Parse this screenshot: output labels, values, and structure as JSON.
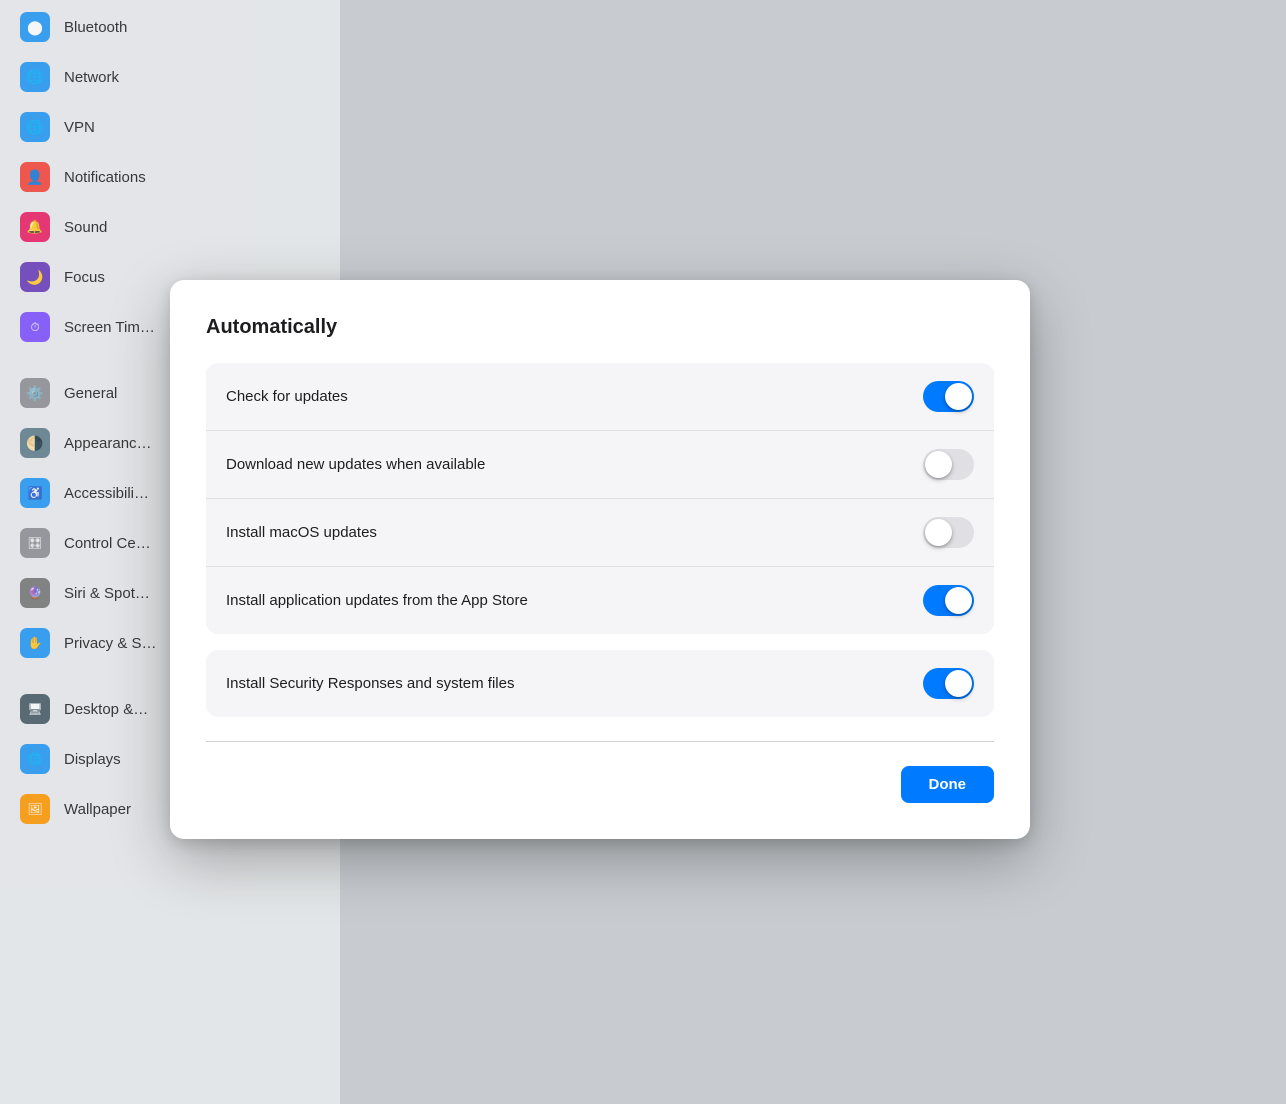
{
  "sidebar": {
    "items": [
      {
        "id": "bluetooth",
        "label": "Bluetooth",
        "icon": "🦷",
        "color": "#2196f3"
      },
      {
        "id": "network",
        "label": "Network",
        "icon": "🌐",
        "color": "#2196f3"
      },
      {
        "id": "vpn",
        "label": "VPN",
        "icon": "🌐",
        "color": "#2196f3"
      },
      {
        "id": "notifications",
        "label": "Notifications",
        "icon": "👤",
        "color": "#f44336"
      },
      {
        "id": "sound",
        "label": "Sound",
        "icon": "🔔",
        "color": "#e91e63"
      },
      {
        "id": "focus",
        "label": "Focus",
        "icon": "🌙",
        "color": "#673ab7"
      },
      {
        "id": "screentime",
        "label": "Screen Time",
        "icon": "⏱",
        "color": "#7c4dff"
      },
      {
        "id": "general",
        "label": "General",
        "icon": "⚙️",
        "color": "#9e9e9e"
      },
      {
        "id": "appearance",
        "label": "Appearance",
        "icon": "🌗",
        "color": "#607d8b"
      },
      {
        "id": "accessibility",
        "label": "Accessibility",
        "icon": "♿",
        "color": "#2196f3"
      },
      {
        "id": "controlcenter",
        "label": "Control Center",
        "icon": "🎛",
        "color": "#9e9e9e"
      },
      {
        "id": "siri",
        "label": "Siri & Spotlight",
        "icon": "🔮",
        "color": "#9c27b0"
      },
      {
        "id": "privacy",
        "label": "Privacy & Security",
        "icon": "✋",
        "color": "#2196f3"
      },
      {
        "id": "desktop",
        "label": "Desktop & Dock",
        "icon": "🖥",
        "color": "#607d8b"
      },
      {
        "id": "displays",
        "label": "Displays",
        "icon": "🌐",
        "color": "#2196f3"
      },
      {
        "id": "wallpaper",
        "label": "Wallpaper",
        "icon": "🖼",
        "color": "#ff9800"
      }
    ]
  },
  "modal": {
    "title": "Automatically",
    "done_label": "Done",
    "rows_group1": [
      {
        "id": "check-updates",
        "label": "Check for updates",
        "state": "on"
      },
      {
        "id": "download-updates",
        "label": "Download new updates when available",
        "state": "off"
      },
      {
        "id": "install-macos",
        "label": "Install macOS updates",
        "state": "off"
      },
      {
        "id": "install-appstore",
        "label": "Install application updates from the App Store",
        "state": "on"
      }
    ],
    "rows_group2": [
      {
        "id": "install-security",
        "label": "Install Security Responses and system files",
        "state": "on"
      }
    ]
  }
}
